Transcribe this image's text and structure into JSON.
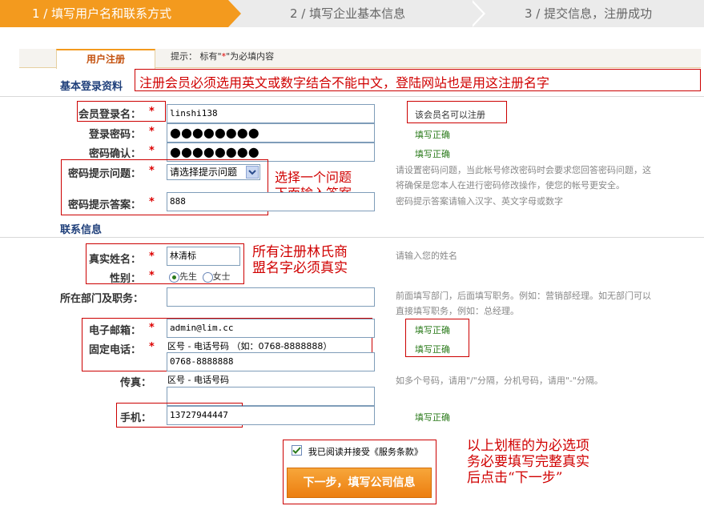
{
  "steps": [
    {
      "label": "1 / 填写用户名和联系方式"
    },
    {
      "label": "2 / 填写企业基本信息"
    },
    {
      "label": "3 / 提交信息，注册成功"
    }
  ],
  "tab": {
    "label": "用户注册"
  },
  "tip": {
    "prefix": "提示： 标有\"",
    "star": "*",
    "suffix": "\"为必填内容"
  },
  "sections": {
    "login": "基本登录资料",
    "contact": "联系信息"
  },
  "annotations": {
    "login_note": "注册会员必须选用英文或数字结合不能中文，登陆网站也是用这注册名字",
    "question_note_1": "选择一个问题",
    "question_note_2": "下面输入答案",
    "name_note_1": "所有注册林氏商",
    "name_note_2": "盟名字必须真实",
    "final_note_1": "以上划框的为必选项",
    "final_note_2": "务必要填写完整真实",
    "final_note_3": "后点击“下一步”"
  },
  "form": {
    "username": {
      "label": "会员登录名：",
      "value": "linshi138",
      "status": "该会员名可以注册"
    },
    "password": {
      "label": "登录密码：",
      "value": "●●●●●●●●",
      "status": "填写正确"
    },
    "password_confirm": {
      "label": "密码确认：",
      "value": "●●●●●●●●",
      "status": "填写正确"
    },
    "question": {
      "label": "密码提示问题：",
      "selected": "请选择提示问题",
      "hint_1": "请设置密码问题，当此帐号修改密码时会要求您回答密码问题，这",
      "hint_2": "将确保是您本人在进行密码修改操作，使您的帐号更安全。"
    },
    "answer": {
      "label": "密码提示答案：",
      "value": "888",
      "hint": "密码提示答案请输入汉字、英文字母或数字"
    },
    "realname": {
      "label": "真实姓名：",
      "value": "林清标",
      "hint": "请输入您的姓名"
    },
    "gender": {
      "label": "性别：",
      "male": "先生",
      "female": "女士"
    },
    "department": {
      "label": "所在部门及职务：",
      "value": "",
      "hint_1": "前面填写部门，后面填写职务。例如：营销部经理。如无部门可以",
      "hint_2": "直接填写职务，例如：总经理。"
    },
    "email": {
      "label": "电子邮箱：",
      "value": "admin@lim.cc",
      "status": "填写正确"
    },
    "phone": {
      "label": "固定电话：",
      "format": "区号 - 电话号码 （如：0768-8888888）",
      "value": "0768-8888888",
      "status": "填写正确"
    },
    "fax": {
      "label": "传真：",
      "format": "区号 - 电话号码",
      "value": "",
      "hint": "如多个号码，请用\"/\"分隔，分机号码，请用\"-\"分隔。"
    },
    "mobile": {
      "label": "手机：",
      "value": "13727944447",
      "status": "填写正确"
    }
  },
  "agreement": {
    "label": "我已阅读并接受《服务条款》",
    "checked": true
  },
  "next_button": {
    "label": "下一步，填写公司信息"
  }
}
